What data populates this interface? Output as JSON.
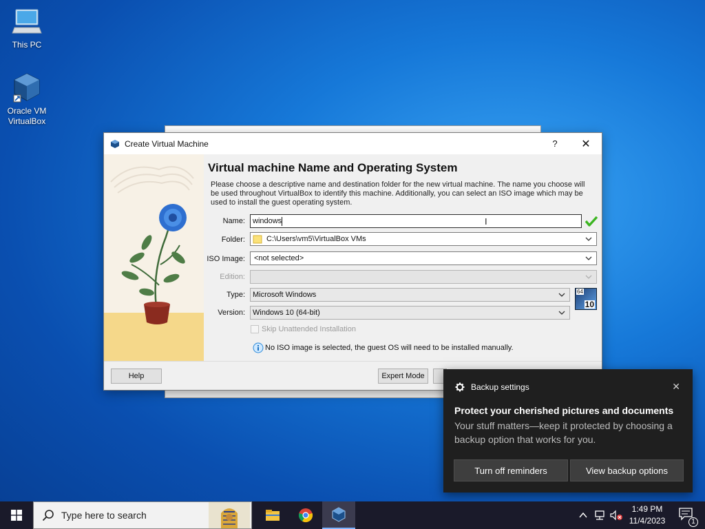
{
  "desktop": {
    "icons": [
      {
        "label": "This PC"
      },
      {
        "label_line1": "Oracle VM",
        "label_line2": "VirtualBox"
      }
    ]
  },
  "dialog": {
    "title": "Create Virtual Machine",
    "help_glyph": "?",
    "close_glyph": "✕",
    "heading": "Virtual machine Name and Operating System",
    "description": "Please choose a descriptive name and destination folder for the new virtual machine. The name you choose will be used throughout VirtualBox to identify this machine. Additionally, you can select an ISO image which may be used to install the guest operating system.",
    "fields": {
      "name_label": "Name:",
      "name_value": "windows",
      "folder_label": "Folder:",
      "folder_value": "C:\\Users\\vm5\\VirtualBox VMs",
      "iso_label": "ISO Image:",
      "iso_value": "<not selected>",
      "edition_label": "Edition:",
      "edition_value": "",
      "type_label": "Type:",
      "type_value": "Microsoft Windows",
      "version_label": "Version:",
      "version_value": "Windows 10 (64-bit)"
    },
    "os_badge": {
      "bits": "64",
      "version": "10"
    },
    "skip_unattended_label": "Skip Unattended Installation",
    "info_text": "No ISO image is selected, the guest OS will need to be installed manually.",
    "buttons": {
      "help": "Help",
      "expert": "Expert Mode"
    }
  },
  "toast": {
    "app": "Backup settings",
    "close_glyph": "✕",
    "title": "Protect your cherished pictures and documents",
    "body": "Your stuff matters—keep it protected by choosing a backup option that works for you.",
    "button_left": "Turn off reminders",
    "button_right": "View backup options"
  },
  "taskbar": {
    "search_placeholder": "Type here to search",
    "time": "1:49 PM",
    "date": "11/4/2023",
    "notification_count": "1"
  },
  "colors": {
    "accent_blue": "#1678d8",
    "check_green": "#3cb521",
    "toast_bg": "#1f1f1f",
    "taskbar_bg": "#1a1a2a"
  }
}
